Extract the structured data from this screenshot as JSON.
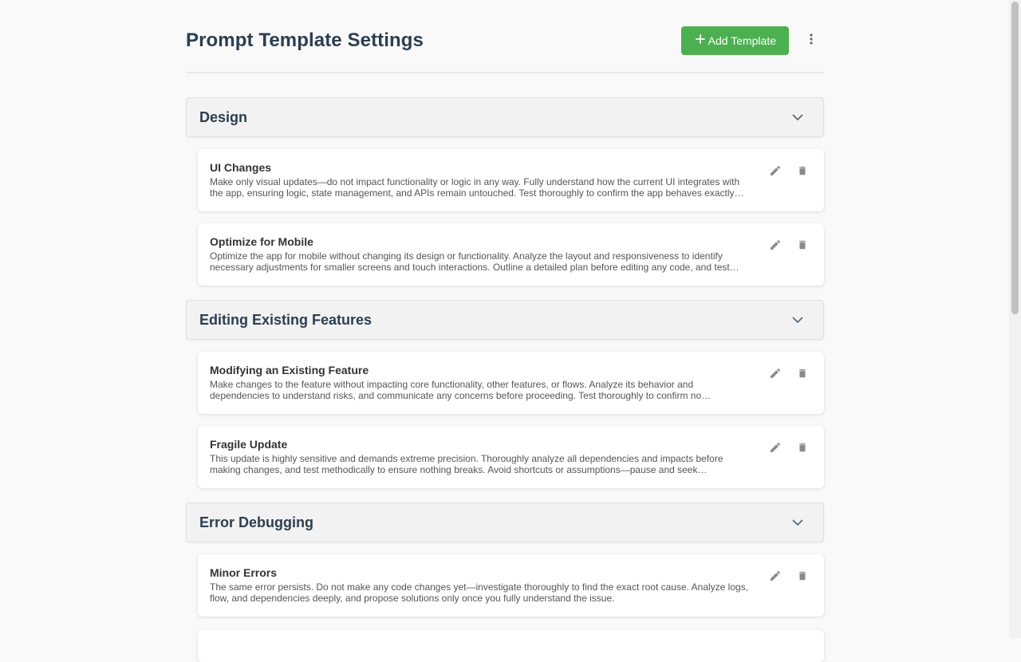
{
  "header": {
    "title": "Prompt Template Settings",
    "add_button_label": "Add Template",
    "add_button_icon": "plus-icon",
    "more_icon": "more-vertical-icon",
    "accent_color": "#4caf50"
  },
  "categories": [
    {
      "title": "Design",
      "templates": [
        {
          "name": "UI Changes",
          "description": "Make only visual updates—do not impact functionality or logic in any way. Fully understand how the current UI integrates with the app, ensuring logic, state management, and APIs remain untouched. Test thoroughly to confirm the app behaves exactly as…"
        },
        {
          "name": "Optimize for Mobile",
          "description": "Optimize the app for mobile without changing its design or functionality. Analyze the layout and responsiveness to identify necessary adjustments for smaller screens and touch interactions. Outline a detailed plan before editing any code, and test…"
        }
      ]
    },
    {
      "title": "Editing Existing Features",
      "templates": [
        {
          "name": "Modifying an Existing Feature",
          "description": "Make changes to the feature without impacting core functionality, other features, or flows. Analyze its behavior and dependencies to understand risks, and communicate any concerns before proceeding. Test thoroughly to confirm no…"
        },
        {
          "name": "Fragile Update",
          "description": "This update is highly sensitive and demands extreme precision. Thoroughly analyze all dependencies and impacts before making changes, and test methodically to ensure nothing breaks. Avoid shortcuts or assumptions—pause and seek clarificatio…"
        }
      ]
    },
    {
      "title": "Error Debugging",
      "templates": [
        {
          "name": "Minor Errors",
          "description": "The same error persists. Do not make any code changes yet—investigate thoroughly to find the exact root cause. Analyze logs, flow, and dependencies deeply, and propose solutions only once you fully understand the issue."
        }
      ]
    }
  ]
}
